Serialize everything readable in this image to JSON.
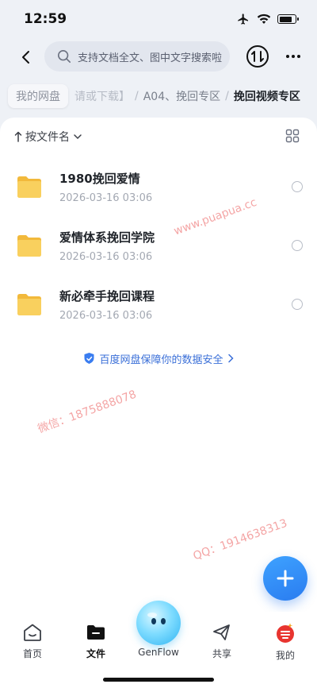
{
  "status_bar": {
    "time": "12:59",
    "battery_level": 0.8
  },
  "search": {
    "placeholder": "支持文档全文、图中文字搜索啦"
  },
  "breadcrumb": {
    "root": "我的网盘",
    "faded": "请或下载】",
    "middle": "A04、挽回专区",
    "current": "挽回视频专区",
    "separator": "/"
  },
  "sort": {
    "label": "按文件名"
  },
  "files": [
    {
      "name": "1980挽回爱情",
      "date": "2026-03-16 03:06"
    },
    {
      "name": "爱情体系挽回学院",
      "date": "2026-03-16 03:06"
    },
    {
      "name": "新必牵手挽回课程",
      "date": "2026-03-16 03:06"
    }
  ],
  "security_note": "百度网盘保障你的数据安全",
  "watermarks": {
    "site": "www.puapua.cc",
    "wechat": "微信：1875888078",
    "qq": "QQ：1914638313"
  },
  "tabs": [
    {
      "label": "首页",
      "icon": "home-icon"
    },
    {
      "label": "文件",
      "icon": "folder-icon",
      "active": true
    },
    {
      "label": "GenFlow",
      "icon": "genflow-icon"
    },
    {
      "label": "共享",
      "icon": "share-icon"
    },
    {
      "label": "我的",
      "icon": "profile-icon"
    }
  ],
  "colors": {
    "accent": "#2a7cf0",
    "folder": "#f7c744",
    "link": "#3a6fd8"
  }
}
